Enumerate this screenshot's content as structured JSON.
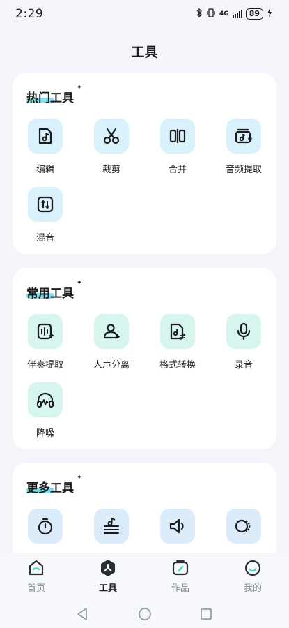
{
  "status_bar": {
    "time": "2:29",
    "network": "4G",
    "battery": "89",
    "bluetooth_icon": "bluetooth-icon",
    "vibrate_icon": "vibrate-icon"
  },
  "header": {
    "title": "工具"
  },
  "sections": [
    {
      "title": "热门工具",
      "tools": [
        {
          "label": "编辑",
          "icon": "edit-note-icon"
        },
        {
          "label": "裁剪",
          "icon": "scissors-icon"
        },
        {
          "label": "合并",
          "icon": "merge-icon"
        },
        {
          "label": "音频提取",
          "icon": "audio-extract-icon"
        },
        {
          "label": "混音",
          "icon": "mix-icon"
        }
      ]
    },
    {
      "title": "常用工具",
      "tools": [
        {
          "label": "伴奏提取",
          "icon": "accompaniment-icon"
        },
        {
          "label": "人声分离",
          "icon": "voice-separate-icon"
        },
        {
          "label": "格式转换",
          "icon": "format-convert-icon"
        },
        {
          "label": "录音",
          "icon": "microphone-icon"
        },
        {
          "label": "降噪",
          "icon": "headphones-icon"
        }
      ]
    },
    {
      "title": "更多工具",
      "tools": [
        {
          "icon": "timer-icon"
        },
        {
          "icon": "equalizer-icon"
        },
        {
          "icon": "volume-icon"
        },
        {
          "icon": "loop-icon"
        }
      ]
    }
  ],
  "bottom_nav": [
    {
      "label": "首页",
      "icon": "home-icon"
    },
    {
      "label": "工具",
      "icon": "tools-icon",
      "active": true
    },
    {
      "label": "作品",
      "icon": "works-icon"
    },
    {
      "label": "我的",
      "icon": "profile-icon"
    }
  ],
  "colors": {
    "blue_tile": "#D9F1FB",
    "mint_tile": "#D6F5EE",
    "sky_tile": "#DCEBFA",
    "accent": "#5FE0D0"
  }
}
